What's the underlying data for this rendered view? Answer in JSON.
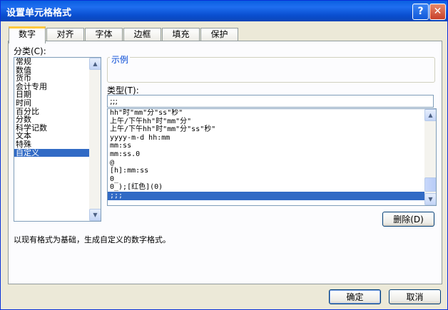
{
  "window": {
    "title": "设置单元格格式"
  },
  "tabs": [
    "数字",
    "对齐",
    "字体",
    "边框",
    "填充",
    "保护"
  ],
  "category": {
    "label": "分类(C):",
    "items": [
      "常规",
      "数值",
      "货币",
      "会计专用",
      "日期",
      "时间",
      "百分比",
      "分数",
      "科学记数",
      "文本",
      "特殊",
      "自定义"
    ],
    "selected": "自定义"
  },
  "sample": {
    "label": "示例"
  },
  "type": {
    "label": "类型(T):",
    "value": ";;;",
    "items": [
      "hh\"时\"mm\"分\"ss\"秒\"",
      "上午/下午hh\"时\"mm\"分\"",
      "上午/下午hh\"时\"mm\"分\"ss\"秒\"",
      "yyyy-m-d hh:mm",
      "mm:ss",
      "mm:ss.0",
      "@",
      "[h]:mm:ss",
      "0_",
      "0_);[红色](0)",
      ";;;"
    ],
    "selected": ";;;"
  },
  "buttons": {
    "delete": "删除(D)",
    "ok": "确定",
    "cancel": "取消"
  },
  "description": "以现有格式为基础，生成自定义的数字格式。"
}
